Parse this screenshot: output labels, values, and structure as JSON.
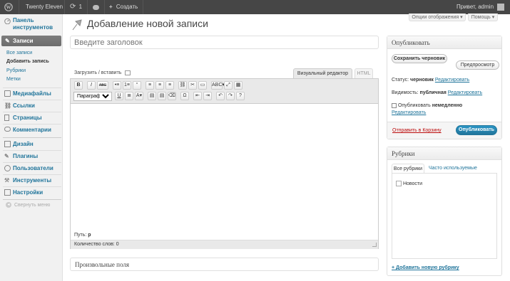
{
  "adminbar": {
    "site_name": "Twenty Eleven",
    "updates_count": "1",
    "new_label": "Создать",
    "greeting": "Привет, admin"
  },
  "screen_options": {
    "options_label": "Опции отображения",
    "help_label": "Помощь"
  },
  "sidebar": {
    "dashboard": "Панель инструментов",
    "posts": "Записи",
    "submenu": [
      "Все записи",
      "Добавить запись",
      "Рубрики",
      "Метки"
    ],
    "items": [
      {
        "label": "Медиафайлы",
        "icon": "media-icon"
      },
      {
        "label": "Ссылки",
        "icon": "links-icon"
      },
      {
        "label": "Страницы",
        "icon": "pages-icon"
      },
      {
        "label": "Комментарии",
        "icon": "comments-icon"
      },
      {
        "label": "Дизайн",
        "icon": "appearance-icon"
      },
      {
        "label": "Плагины",
        "icon": "plugins-icon"
      },
      {
        "label": "Пользователи",
        "icon": "users-icon"
      },
      {
        "label": "Инструменты",
        "icon": "tools-icon"
      },
      {
        "label": "Настройки",
        "icon": "settings-icon"
      }
    ],
    "collapse": "Свернуть меню"
  },
  "page": {
    "title": "Добавление новой записи",
    "title_placeholder": "Введите заголовок"
  },
  "editor": {
    "upload_label": "Загрузить / вставить",
    "tab_visual": "Визуальный редактор",
    "tab_html": "HTML",
    "format_select": "Параграф",
    "toolbar_row1": [
      "B",
      "I",
      "ABC",
      "•≡",
      "1≡",
      "“",
      "≡",
      "≡",
      "≡",
      "⛓",
      "✂",
      "▭",
      "ABC▾",
      "⤢",
      "▦"
    ],
    "toolbar_row2": [
      "U",
      "≣",
      "A▾",
      "▤",
      "▤",
      "⌫",
      "Ω",
      "⇤",
      "⇥",
      "↶",
      "↷",
      "?"
    ],
    "path_label": "Путь:",
    "path_value": "p",
    "word_count_label": "Количество слов:",
    "word_count_value": "0"
  },
  "custom_fields": {
    "title": "Произвольные поля"
  },
  "publish": {
    "title": "Опубликовать",
    "save_draft": "Сохранить черновик",
    "preview": "Предпросмотр",
    "status_label": "Статус:",
    "status_value": "черновик",
    "status_edit": "Редактировать",
    "visibility_label": "Видимость:",
    "visibility_value": "публичная",
    "visibility_edit": "Редактировать",
    "schedule_label": "Опубликовать",
    "schedule_value": "немедленно",
    "schedule_edit": "Редактировать",
    "trash": "Отправить в Корзину",
    "publish_button": "Опубликовать"
  },
  "categories": {
    "title": "Рубрики",
    "tab_all": "Все рубрики",
    "tab_popular": "Часто используемые",
    "items": [
      {
        "label": "Новости",
        "checked": false
      }
    ],
    "add_new": "+ Добавить новую рубрику"
  },
  "colors": {
    "link": "#21759b",
    "adminbar": "#464646",
    "trash": "#bc0b0b"
  }
}
